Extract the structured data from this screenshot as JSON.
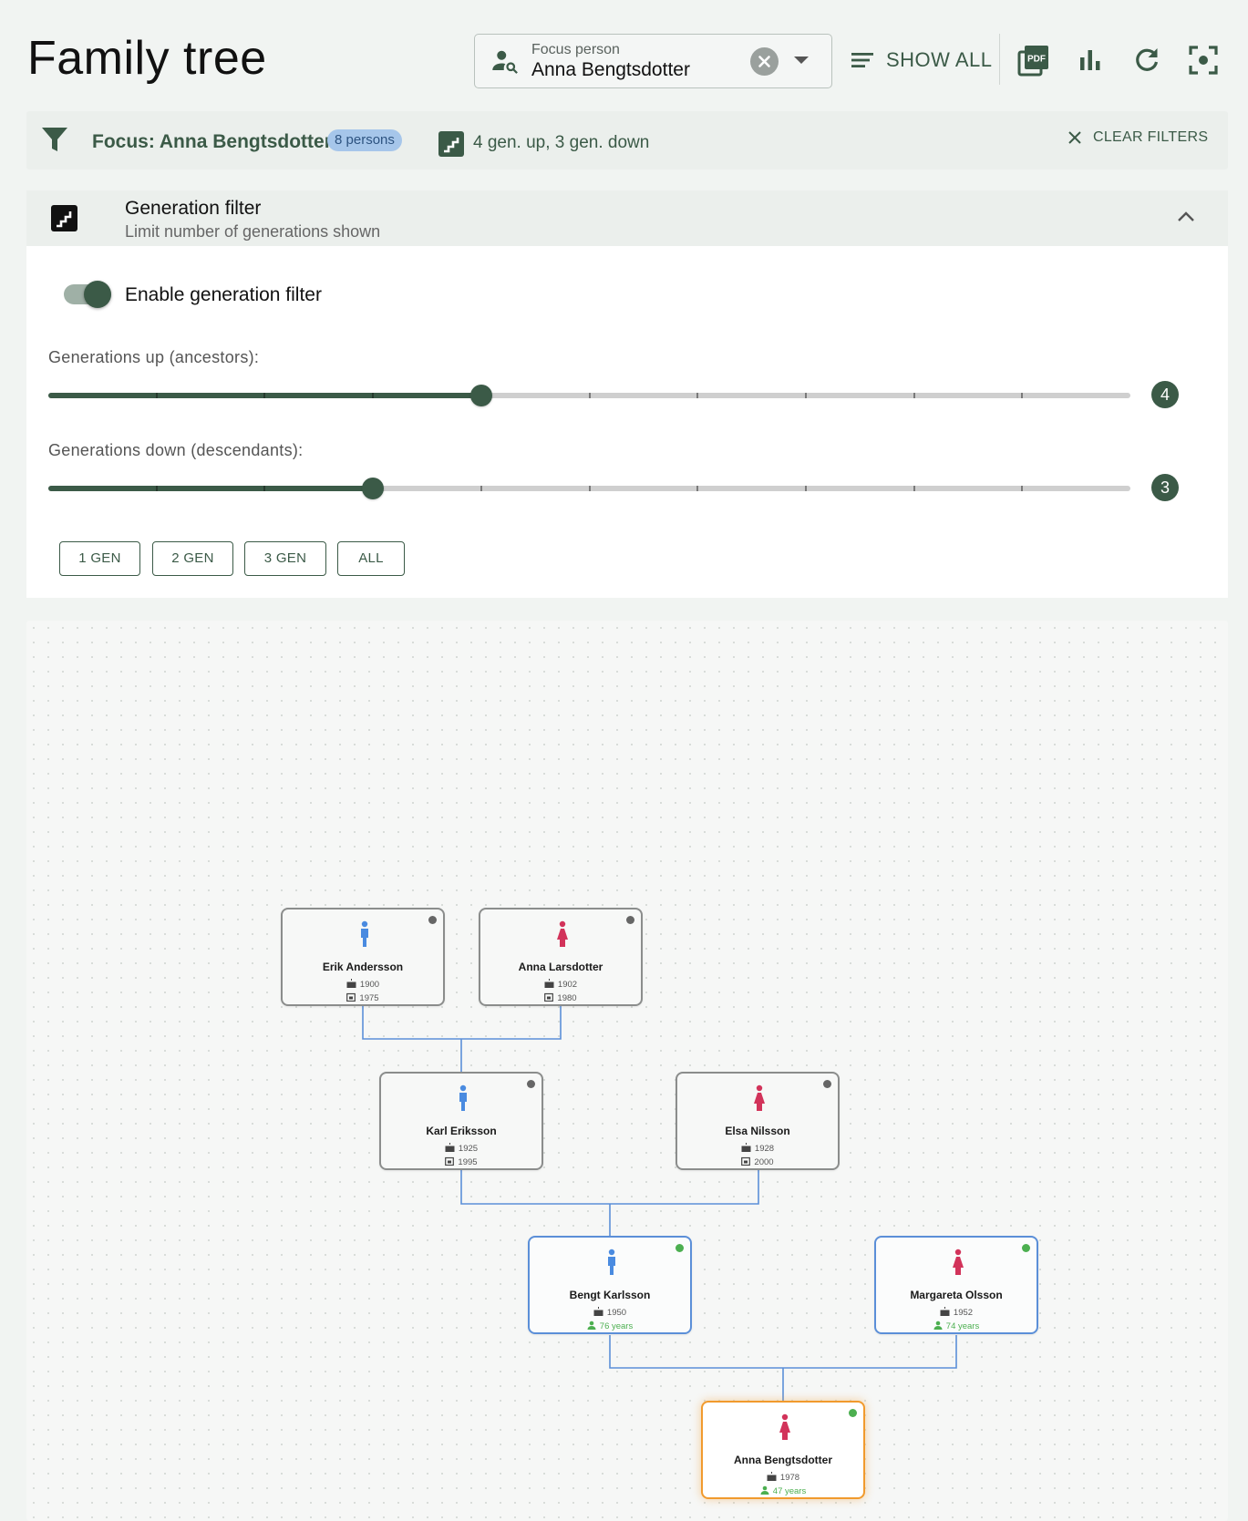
{
  "header": {
    "title": "Family tree",
    "focus_label": "Focus person",
    "focus_value": "Anna Bengtsdotter",
    "show_all": "SHOW ALL",
    "toolbar_icons": [
      "pdf-icon",
      "bar-chart-icon",
      "refresh-icon",
      "center-focus-icon"
    ]
  },
  "summary": {
    "focus_text": "Focus: Anna Bengtsdotter",
    "badge": "8 persons",
    "generations": "4 gen. up, 3 gen. down",
    "clear": "CLEAR FILTERS"
  },
  "gen_filter": {
    "title": "Generation filter",
    "subtitle": "Limit number of generations shown",
    "toggle_label": "Enable generation filter",
    "toggle_on": true,
    "up_label": "Generations up (ancestors):",
    "up_value": "4",
    "down_label": "Generations down (descendants):",
    "down_value": "3",
    "slider_max": 10,
    "quick_buttons": [
      "1 GEN",
      "2 GEN",
      "3 GEN",
      "ALL"
    ]
  },
  "tree": {
    "people": [
      {
        "name": "Erik Andersson",
        "birth": "1900",
        "death": "1975",
        "gender": "male",
        "status": "deceased"
      },
      {
        "name": "Anna Larsdotter",
        "birth": "1902",
        "death": "1980",
        "gender": "female",
        "status": "deceased"
      },
      {
        "name": "Karl Eriksson",
        "birth": "1925",
        "death": "1995",
        "gender": "male",
        "status": "deceased"
      },
      {
        "name": "Elsa Nilsson",
        "birth": "1928",
        "death": "2000",
        "gender": "female",
        "status": "deceased"
      },
      {
        "name": "Bengt Karlsson",
        "birth": "1950",
        "age": "76 years",
        "gender": "male",
        "status": "living"
      },
      {
        "name": "Margareta Olsson",
        "birth": "1952",
        "age": "74 years",
        "gender": "female",
        "status": "living"
      },
      {
        "name": "Anna Bengtsdotter",
        "birth": "1978",
        "age": "47 years",
        "gender": "female",
        "status": "focus"
      }
    ]
  },
  "colors": {
    "primary": "#3b5a47",
    "male": "#4a8be0",
    "female": "#d2335a",
    "living_border": "#5b8fd8",
    "focus_border": "#f19a2d",
    "link": "#5b8fd8"
  }
}
